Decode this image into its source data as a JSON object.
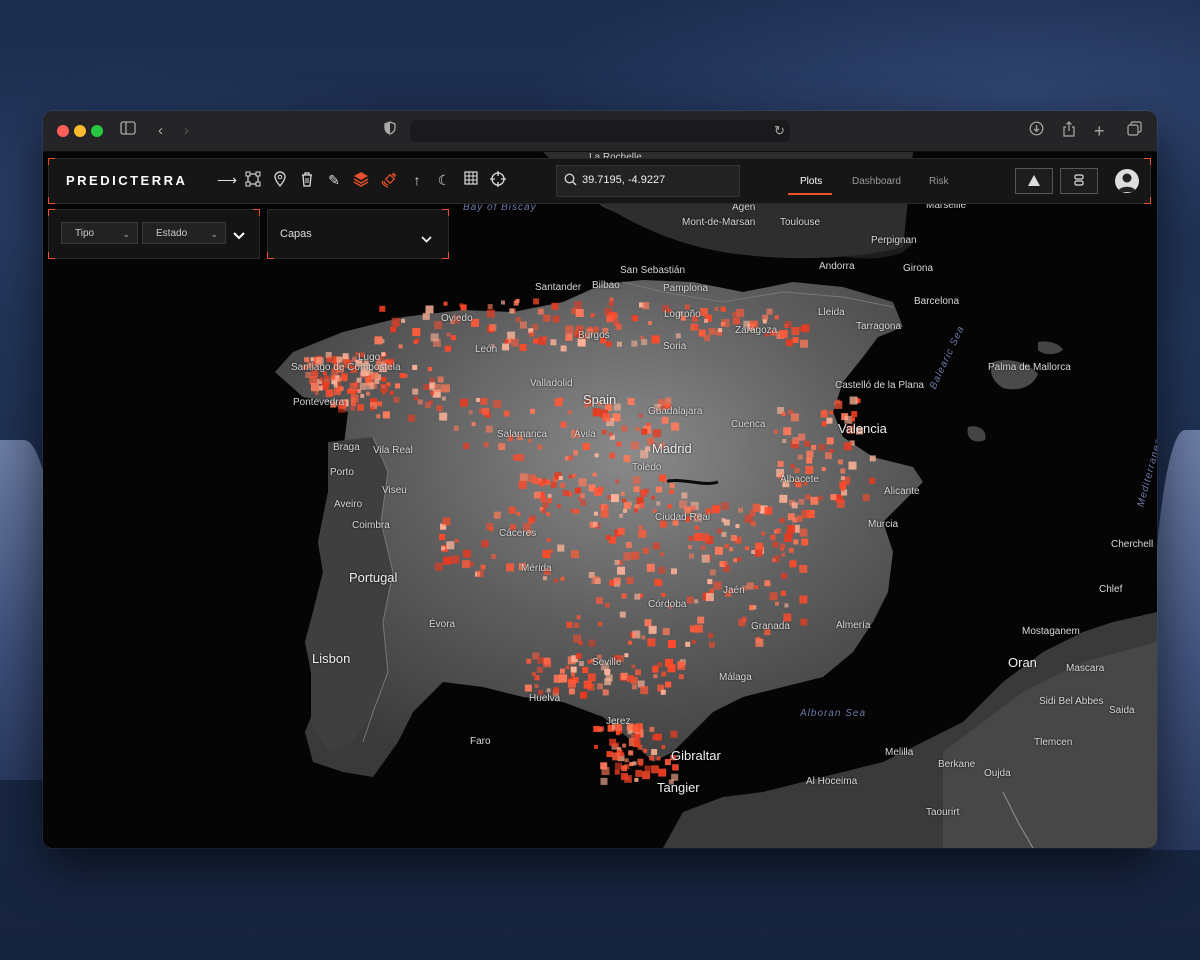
{
  "app": {
    "logo": "PREDICTERRA",
    "search": {
      "value": "39.7195, -4.9227"
    },
    "nav": [
      {
        "label": "Plots",
        "active": true
      },
      {
        "label": "Dashboard",
        "active": false
      },
      {
        "label": "Risk",
        "active": false
      }
    ],
    "toolbar_icons": [
      "line-tool-icon",
      "polygon-tool-icon",
      "pin-icon",
      "trash-icon",
      "pencil-icon",
      "layers-icon",
      "satellite-icon",
      "north-arrow-icon",
      "dark-mode-icon",
      "grid-icon",
      "crosshair-icon"
    ],
    "right_buttons": [
      "alert-icon",
      "database-icon",
      "user-icon"
    ],
    "accent_color": "#e8502c"
  },
  "filters": {
    "tipo": "Tipo",
    "estado": "Estado",
    "capas": "Capas"
  },
  "map": {
    "countries": [
      {
        "name": "Spain"
      },
      {
        "name": "Portugal"
      }
    ],
    "seas": [
      {
        "name": "Bay of Biscay"
      },
      {
        "name": "Balearic Sea"
      },
      {
        "name": "Mediterranean Sea"
      },
      {
        "name": "Alboran Sea"
      }
    ],
    "cities": [
      {
        "name": "La Rochelle"
      },
      {
        "name": "Agen"
      },
      {
        "name": "Mont-de-Marsan"
      },
      {
        "name": "Toulouse"
      },
      {
        "name": "Marseille"
      },
      {
        "name": "Perpignan"
      },
      {
        "name": "Andorra"
      },
      {
        "name": "Girona"
      },
      {
        "name": "Barcelona"
      },
      {
        "name": "Lleida"
      },
      {
        "name": "Tarragona"
      },
      {
        "name": "San Sebastián"
      },
      {
        "name": "Santander"
      },
      {
        "name": "Bilbao"
      },
      {
        "name": "Pamplona"
      },
      {
        "name": "Oviedo"
      },
      {
        "name": "Logroño"
      },
      {
        "name": "Zaragoza"
      },
      {
        "name": "Burgos"
      },
      {
        "name": "Soria"
      },
      {
        "name": "León"
      },
      {
        "name": "Lugo"
      },
      {
        "name": "Santiago de Compostela"
      },
      {
        "name": "Pontevedra"
      },
      {
        "name": "Valladolid"
      },
      {
        "name": "Guadalajara"
      },
      {
        "name": "Salamanca"
      },
      {
        "name": "Ávila"
      },
      {
        "name": "Madrid"
      },
      {
        "name": "Cuenca"
      },
      {
        "name": "Castelló de la Plana"
      },
      {
        "name": "Valencia"
      },
      {
        "name": "Palma de Mallorca"
      },
      {
        "name": "Braga"
      },
      {
        "name": "Vila Real"
      },
      {
        "name": "Porto"
      },
      {
        "name": "Viseu"
      },
      {
        "name": "Aveiro"
      },
      {
        "name": "Coimbra"
      },
      {
        "name": "Toledo"
      },
      {
        "name": "Albacete"
      },
      {
        "name": "Alicante"
      },
      {
        "name": "Ciudad Real"
      },
      {
        "name": "Cáceres"
      },
      {
        "name": "Murcia"
      },
      {
        "name": "Mérida"
      },
      {
        "name": "Cherchell"
      },
      {
        "name": "Chlef"
      },
      {
        "name": "Jaén"
      },
      {
        "name": "Córdoba"
      },
      {
        "name": "Évora"
      },
      {
        "name": "Granada"
      },
      {
        "name": "Almería"
      },
      {
        "name": "Lisbon"
      },
      {
        "name": "Mostaganem"
      },
      {
        "name": "Oran"
      },
      {
        "name": "Mascara"
      },
      {
        "name": "Seville"
      },
      {
        "name": "Málaga"
      },
      {
        "name": "Huelva"
      },
      {
        "name": "Sidi Bel Abbes"
      },
      {
        "name": "Saida"
      },
      {
        "name": "Jerez"
      },
      {
        "name": "Faro"
      },
      {
        "name": "Tlemcen"
      },
      {
        "name": "Melilla"
      },
      {
        "name": "Gibraltar"
      },
      {
        "name": "Berkane"
      },
      {
        "name": "Oujda"
      },
      {
        "name": "Al Hoceima"
      },
      {
        "name": "Tangier"
      },
      {
        "name": "Taourirt"
      }
    ]
  }
}
